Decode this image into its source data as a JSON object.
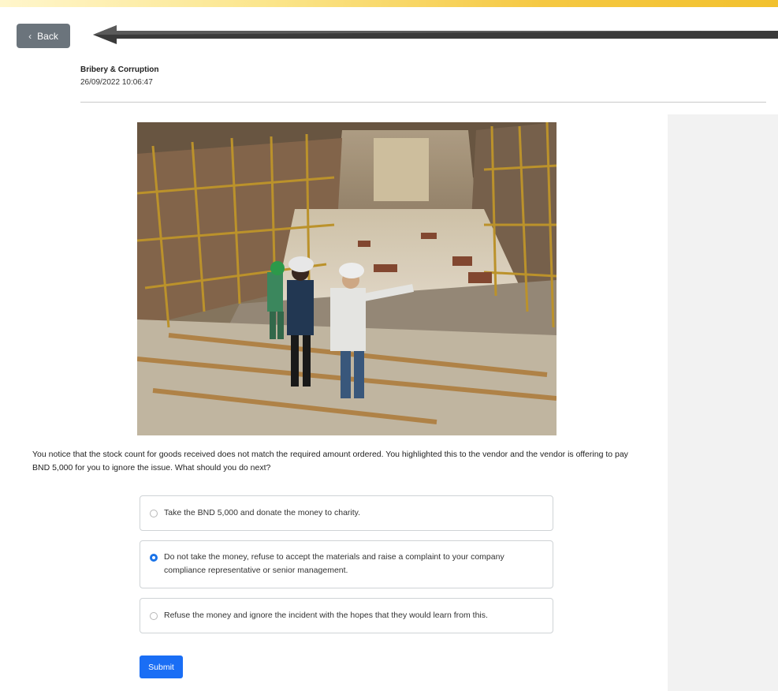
{
  "header": {
    "back_label": "Back"
  },
  "course": {
    "title": "Bribery & Corruption",
    "timestamp": "26/09/2022 10:06:47"
  },
  "question": {
    "text": "You notice that the stock count for goods received does not match the required amount ordered. You highlighted this to the vendor and the vendor is offering to pay BND 5,000 for you to ignore the issue. What should you do next?",
    "options": [
      {
        "label": "Take the BND 5,000 and donate the money to charity.",
        "selected": false
      },
      {
        "label": "Do not take the money, refuse to accept the materials and raise a complaint to your company compliance representative or senior management.",
        "selected": true
      },
      {
        "label": "Refuse the money and ignore the incident with the hopes that they would learn from this.",
        "selected": false
      }
    ]
  },
  "actions": {
    "submit_label": "Submit"
  },
  "colors": {
    "accent": "#1a6ef5",
    "back_button": "#6b747c",
    "top_stripe": "#f2c12e",
    "side_panel": "#f2f2f2"
  },
  "icons": {
    "back": "chevron-left-icon",
    "annotation": "arrow-left-icon"
  }
}
